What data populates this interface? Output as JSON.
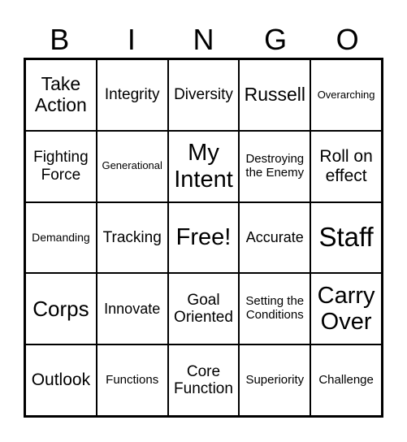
{
  "header": {
    "letters": [
      "B",
      "I",
      "N",
      "G",
      "O"
    ]
  },
  "card": {
    "cells": [
      "Take Action",
      "Integrity",
      "Diversity",
      "Russell",
      "Overarching",
      "Fighting Force",
      "Generational",
      "My Intent",
      "Destroying the Enemy",
      "Roll on effect",
      "Demanding",
      "Tracking",
      "Free!",
      "Accurate",
      "Staff",
      "Corps",
      "Innovate",
      "Goal Oriented",
      "Setting the Conditions",
      "Carry Over",
      "Outlook",
      "Functions",
      "Core Function",
      "Superiority",
      "Challenge"
    ]
  }
}
